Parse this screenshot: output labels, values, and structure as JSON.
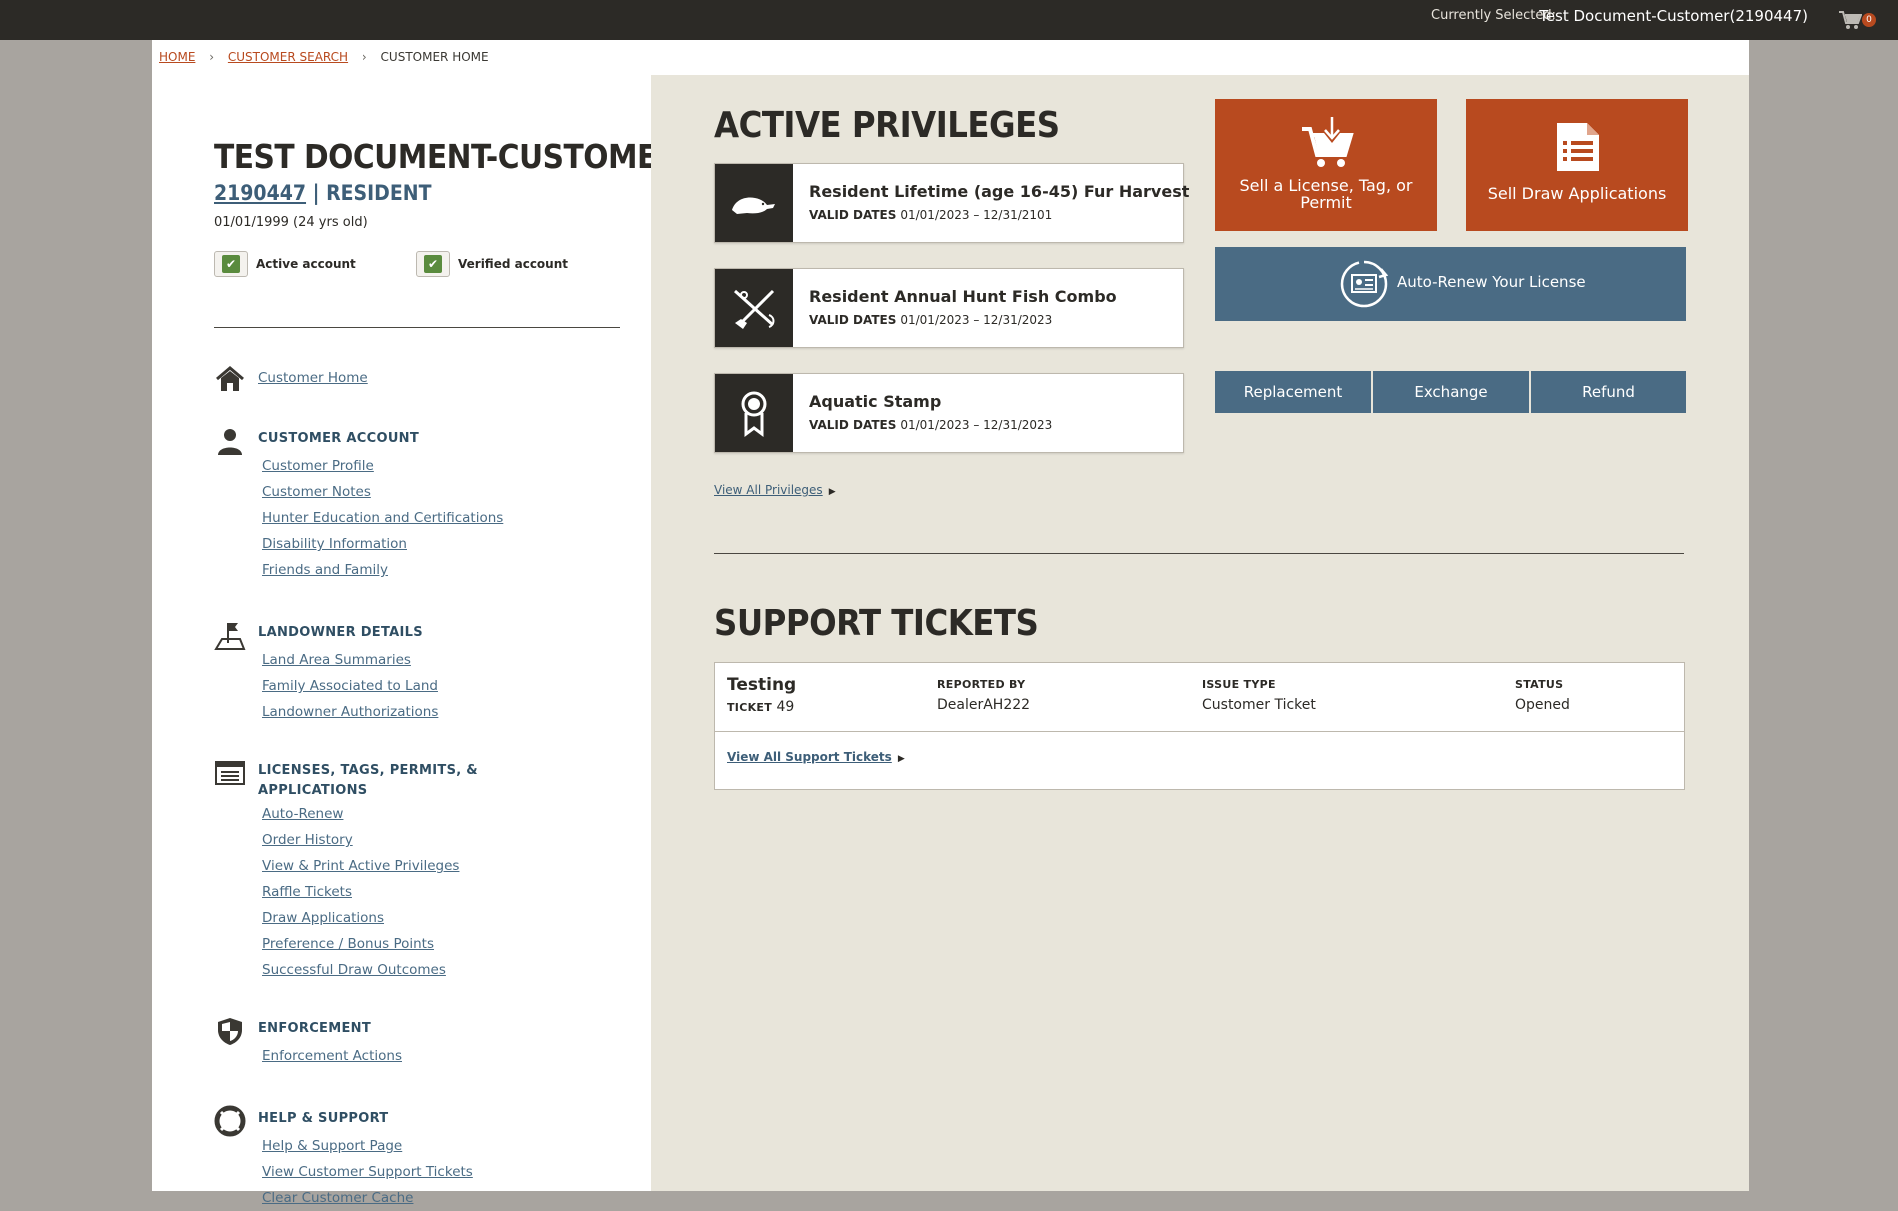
{
  "topbar": {
    "currently_selected_label": "Currently Selected:",
    "currently_selected_value": "Test Document-Customer(2190447)",
    "cart_count": "0"
  },
  "breadcrumb": {
    "home": "HOME",
    "customer_search": "CUSTOMER SEARCH",
    "current": "CUSTOMER HOME",
    "separator": "›"
  },
  "customer": {
    "name": "TEST DOCUMENT-CUSTOMER",
    "id": "2190447",
    "residency": "| RESIDENT",
    "dob": "01/01/1999 (24 yrs old)",
    "active_label": "Active account",
    "verified_label": "Verified account",
    "check_glyph": "✔"
  },
  "nav": {
    "home_link": "Customer Home",
    "sections": [
      {
        "title": "CUSTOMER ACCOUNT",
        "links": [
          "Customer Profile",
          "Customer Notes",
          "Hunter Education and Certifications",
          "Disability Information",
          "Friends and Family"
        ]
      },
      {
        "title": "LANDOWNER DETAILS",
        "links": [
          "Land Area Summaries",
          "Family Associated to Land",
          "Landowner Authorizations"
        ]
      },
      {
        "title": "LICENSES, TAGS, PERMITS, &",
        "title2": "APPLICATIONS",
        "links": [
          "Auto-Renew",
          "Order History",
          "View & Print Active Privileges",
          "Raffle Tickets",
          "Draw Applications",
          "Preference / Bonus Points",
          "Successful Draw Outcomes"
        ]
      },
      {
        "title": "ENFORCEMENT",
        "links": [
          "Enforcement Actions"
        ]
      },
      {
        "title": "HELP & SUPPORT",
        "links": [
          "Help & Support Page",
          "View Customer Support Tickets",
          "Clear Customer Cache"
        ]
      }
    ]
  },
  "privileges": {
    "heading": "ACTIVE PRIVILEGES",
    "dates_label": "VALID DATES",
    "items": [
      {
        "name": "Resident Lifetime (age 16-45) Fur Harvest",
        "dates": "01/01/2023 – 12/31/2101",
        "icon": "beaver-icon"
      },
      {
        "name": "Resident Annual Hunt Fish Combo",
        "dates": "01/01/2023 – 12/31/2023",
        "icon": "rifle-rod-icon"
      },
      {
        "name": "Aquatic Stamp",
        "dates": "01/01/2023 – 12/31/2023",
        "icon": "ribbon-badge-icon"
      }
    ],
    "view_all": "View All Privileges",
    "arrow": "▶"
  },
  "actions": {
    "sell_license_line1": "Sell a License, Tag, or",
    "sell_license_line2": "Permit",
    "sell_draw": "Sell Draw Applications",
    "auto_renew": "Auto-Renew Your License",
    "replacement": "Replacement",
    "exchange": "Exchange",
    "refund": "Refund"
  },
  "support": {
    "heading": "SUPPORT TICKETS",
    "ticket_title": "Testing",
    "ticket_label": "TICKET",
    "ticket_number": "49",
    "reported_by_label": "REPORTED BY",
    "reported_by": "DealerAH222",
    "issue_type_label": "ISSUE TYPE",
    "issue_type": "Customer Ticket",
    "status_label": "STATUS",
    "status": "Opened",
    "view_all": "View All Support Tickets",
    "arrow": "▶"
  },
  "colors": {
    "topbar": "#2c2a26",
    "accent_orange": "#b84a1f",
    "accent_blue": "#4a6b84",
    "panel_bg": "#e8e5da",
    "check_green": "#5a8b3e"
  }
}
